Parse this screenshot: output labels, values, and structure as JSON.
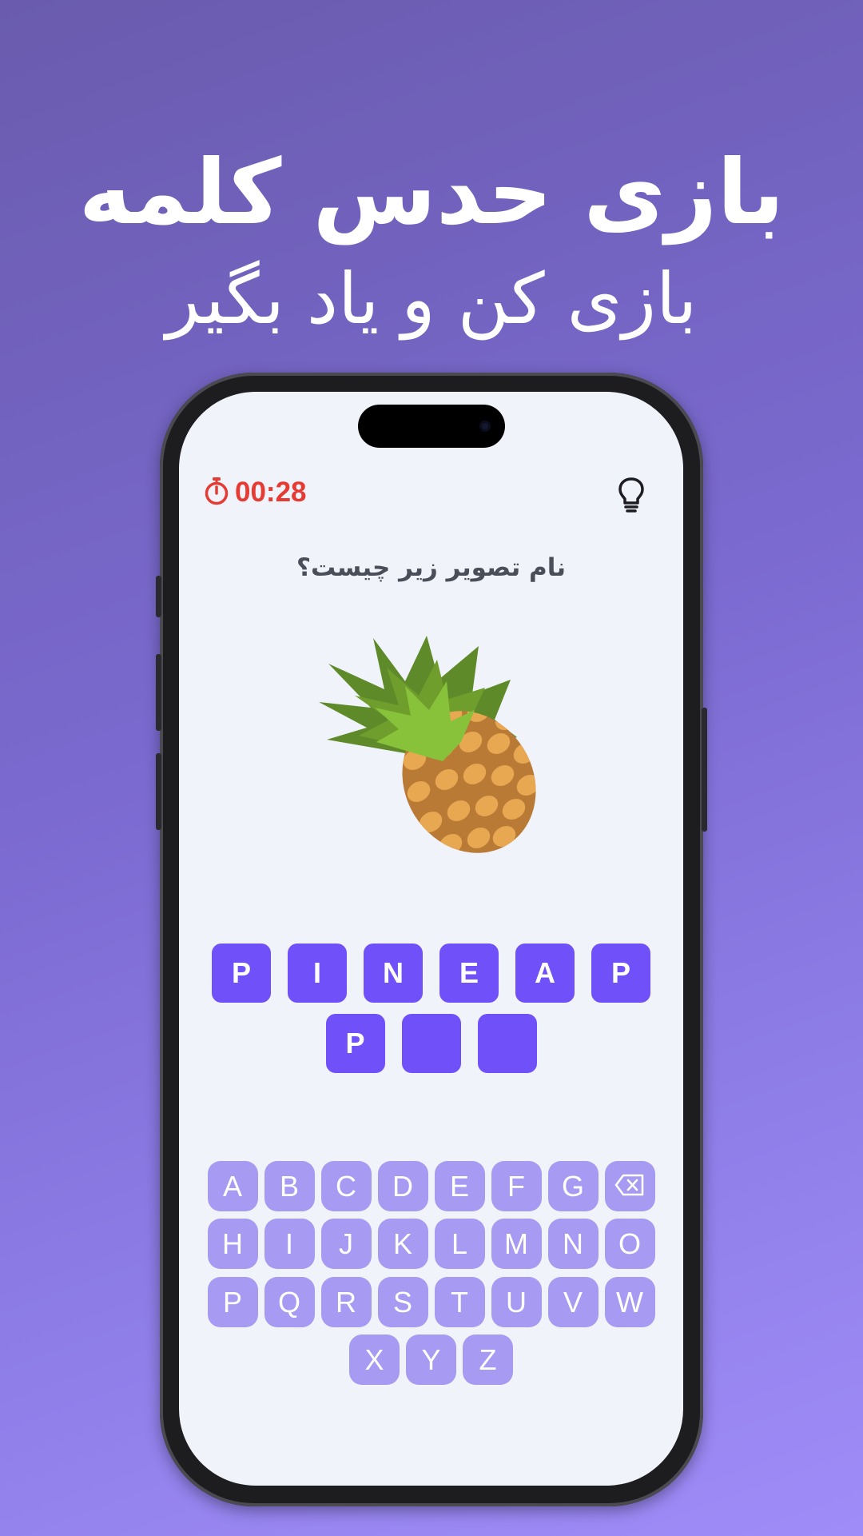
{
  "promo": {
    "title": "بازی حدس کلمه",
    "subtitle": "بازی کن و یاد بگیر"
  },
  "game": {
    "timer": "00:28",
    "question": "نام تصویر زیر چیست؟",
    "image_icon": "pineapple-image",
    "answer_slots_row1": [
      "P",
      "I",
      "N",
      "E",
      "A",
      "P"
    ],
    "answer_slots_row2": [
      "P",
      "",
      ""
    ],
    "keyboard": {
      "row1": [
        "A",
        "B",
        "C",
        "D",
        "E",
        "F",
        "G"
      ],
      "row2": [
        "H",
        "I",
        "J",
        "K",
        "L",
        "M",
        "N",
        "O"
      ],
      "row3": [
        "P",
        "Q",
        "R",
        "S",
        "T",
        "U",
        "V",
        "W"
      ],
      "row4": [
        "X",
        "Y",
        "Z"
      ],
      "backspace_icon": "backspace-icon"
    }
  },
  "colors": {
    "accent": "#7051f9",
    "key": "#a69af2",
    "timer": "#e53b33",
    "background_top": "#6a5bae",
    "background_bottom": "#a08cf8"
  }
}
